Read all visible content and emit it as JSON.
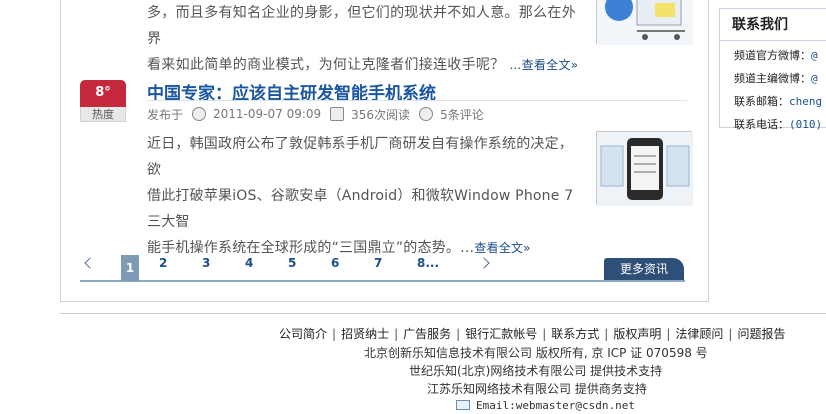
{
  "previous_article": {
    "line1": "多，而且多有知名企业的身影，但它们的现状并不如人意。那么在外界",
    "line2": "看来如此简单的商业模式，为何让克隆者们接连收手呢？",
    "read_more": "…查看全文»"
  },
  "article": {
    "heat_value": "8°",
    "heat_label": "热度",
    "title": "中国专家：应该自主研发智能手机系统",
    "published_prefix": "发布于",
    "date": "2011-09-07 09:09",
    "reads": "356次阅读",
    "comments": "5条评论",
    "summary_line1": "近日，韩国政府公布了敦促韩系手机厂商研发自有操作系统的决定，欲",
    "summary_line2": "借此打破苹果iOS、谷歌安卓（Android）和微软Window Phone 7三大智",
    "summary_line3": "能手机操作系统在全球形成的“三国鼎立”的态势。…",
    "read_more": "查看全文»"
  },
  "pagination": {
    "current": "1",
    "pages": [
      "2",
      "3",
      "4",
      "5",
      "6",
      "7",
      "8..."
    ],
    "more_button": "更多资讯"
  },
  "sidebar": {
    "title": "联系我们",
    "rows": [
      {
        "label": "频道官方微博：",
        "value": "@"
      },
      {
        "label": "频道主编微博：",
        "value": "@"
      },
      {
        "label": "联系邮箱：",
        "value": "cheng"
      },
      {
        "label": "联系电话：",
        "value": "(010)"
      }
    ]
  },
  "footer": {
    "links": [
      "公司简介",
      "招贤纳士",
      "广告服务",
      "银行汇款帐号",
      "联系方式",
      "版权声明",
      "法律顾问",
      "问题报告"
    ],
    "copyright": "北京创新乐知信息技术有限公司 版权所有, 京 ICP 证 070598 号",
    "tech_support": "世纪乐知(北京)网络技术有限公司 提供技术支持",
    "business_support": "江苏乐知网络技术有限公司 提供商务支持",
    "email": "Email:webmaster@csdn.net"
  }
}
